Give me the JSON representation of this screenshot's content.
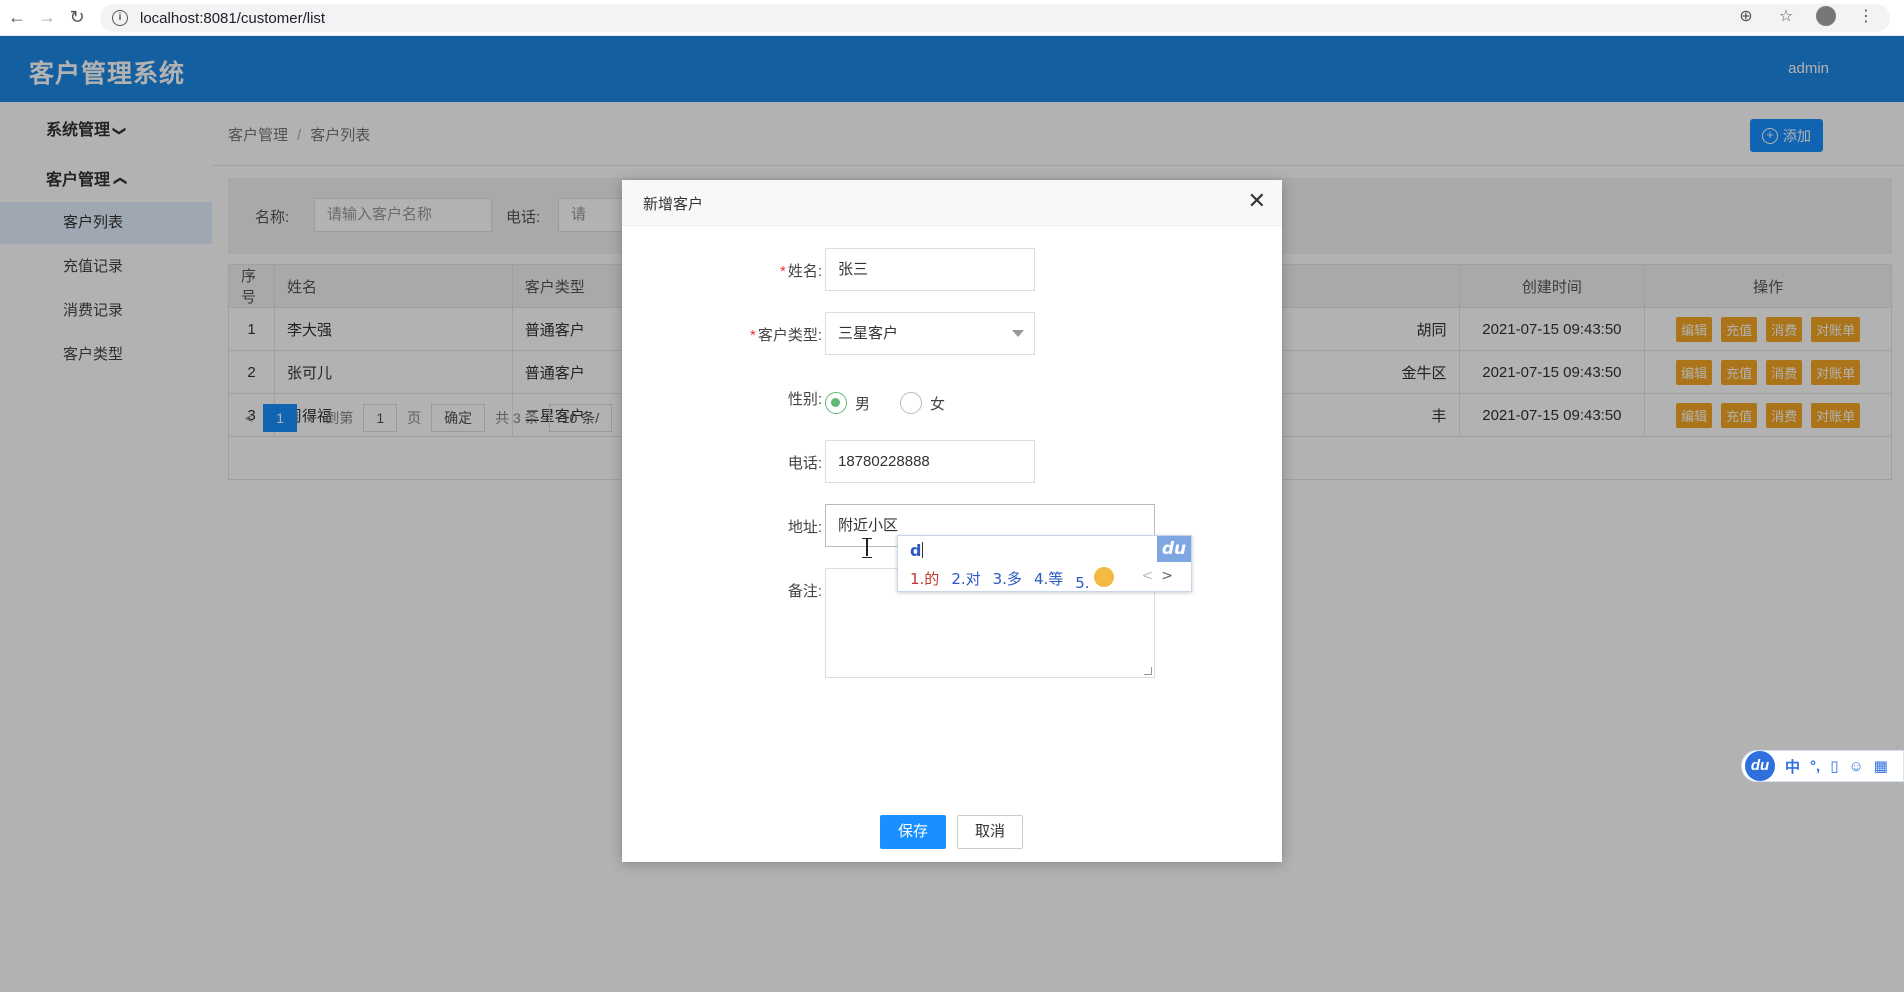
{
  "browser": {
    "url": "localhost:8081/customer/list"
  },
  "header": {
    "title": "客户管理系统",
    "user": "admin"
  },
  "sidebar": {
    "groups": [
      {
        "label": "系统管理",
        "chevron": "chevron-down-icon"
      },
      {
        "label": "客户管理",
        "chevron": "chevron-up-icon"
      }
    ],
    "items": [
      {
        "label": "客户列表",
        "active": true
      },
      {
        "label": "充值记录",
        "active": false
      },
      {
        "label": "消费记录",
        "active": false
      },
      {
        "label": "客户类型",
        "active": false
      }
    ]
  },
  "breadcrumb": [
    "客户管理",
    "客户列表"
  ],
  "toolbar": {
    "add_label": "添加"
  },
  "filters": {
    "name_label": "名称:",
    "name_placeholder": "请输入客户名称",
    "phone_label": "电话:",
    "phone_placeholder": "请"
  },
  "table": {
    "columns": [
      "序号",
      "姓名",
      "客户类型",
      "创建时间",
      "操作"
    ],
    "rows": [
      {
        "idx": "1",
        "name": "李大强",
        "type": "普通客户",
        "addr": "胡同",
        "created": "2021-07-15 09:43:50"
      },
      {
        "idx": "2",
        "name": "张可儿",
        "type": "普通客户",
        "addr": "金牛区",
        "created": "2021-07-15 09:43:50"
      },
      {
        "idx": "3",
        "name": "周得福",
        "type": "二星客户",
        "addr": "丰",
        "created": "2021-07-15 09:43:50"
      }
    ],
    "ops": [
      "编辑",
      "充值",
      "消费",
      "对账单"
    ]
  },
  "pager": {
    "current": "1",
    "goto_label": "到第",
    "goto_value": "1",
    "page_label": "页",
    "confirm_label": "确定",
    "total_label": "共 3 条",
    "size_label": "10 条/"
  },
  "modal": {
    "title": "新增客户",
    "fields": {
      "name_label": "姓名:",
      "name_value": "张三",
      "type_label": "客户类型:",
      "type_value": "三星客户",
      "gender_label": "性别:",
      "gender_male": "男",
      "gender_female": "女",
      "phone_label": "电话:",
      "phone_value": "18780228888",
      "address_label": "地址:",
      "address_value": "附近小区",
      "remark_label": "备注:"
    },
    "save_label": "保存",
    "cancel_label": "取消"
  },
  "ime": {
    "composition": "d",
    "candidates": [
      "1.的",
      "2.对",
      "3.多",
      "4.等",
      "5."
    ],
    "logo": "du",
    "bar": [
      "中",
      "°,"
    ]
  },
  "colors": {
    "header_blue": "#1e88e5",
    "primary": "#1890ff",
    "op_orange": "#f5a623",
    "radio_green": "#5fb878"
  }
}
